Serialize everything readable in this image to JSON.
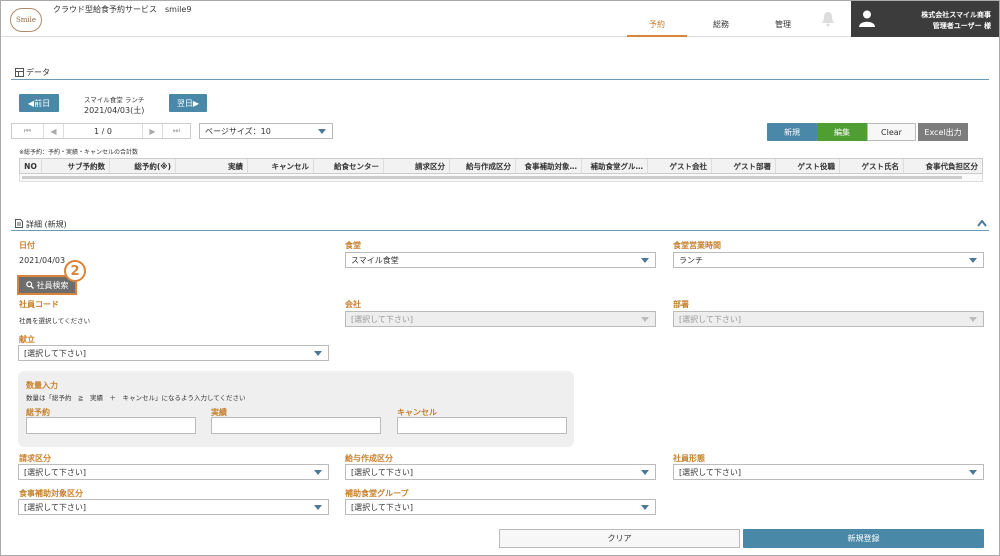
{
  "header": {
    "logo": "Smile",
    "title": "クラウド型給食予約サービス　smile9",
    "nav": [
      "予約",
      "総務",
      "管理"
    ],
    "company": "株式会社スマイル商事",
    "user": "管理者ユーザー 様"
  },
  "data_section": {
    "title": "データ",
    "prev_label": "◀前日",
    "next_label": "翌日▶",
    "canteen_meal": "スマイル食堂 ランチ",
    "date": "2021/04/03(土)",
    "pager_text": "1 / 0",
    "page_size": "ページサイズ：10",
    "new_label": "新規",
    "edit_label": "編集",
    "clear_label": "Clear",
    "excel_label": "Excel出力",
    "note": "※総予約：予約・実績・キャンセルの合計数",
    "columns": [
      "NO",
      "サブ予約数",
      "総予約(※)",
      "実績",
      "キャンセル",
      "給食センター",
      "請求区分",
      "給与作成区分",
      "食事補助対象…",
      "補助食堂グル…",
      "ゲスト会社",
      "ゲスト部署",
      "ゲスト役職",
      "ゲスト氏名",
      "食事代負担区分"
    ]
  },
  "detail": {
    "title": "詳細 (新規)",
    "date_label": "日付",
    "date_value": "2021/04/03",
    "canteen_label": "食堂",
    "canteen_value": "スマイル食堂",
    "hours_label": "食堂営業時間",
    "hours_value": "ランチ",
    "search_label": "社員検索",
    "callout": "2",
    "emp_code_label": "社員コード",
    "emp_hint": "社員を選択してください",
    "company_label": "会社",
    "dept_label": "部署",
    "placeholder": "[選択して下さい]",
    "menu_label": "献立",
    "qty_title": "数量入力",
    "qty_note": "数量は「総予約　≧　実績　＋　キャンセル」になるよう入力してください",
    "total_label": "総予約",
    "actual_label": "実績",
    "cancel_label": "キャンセル",
    "billing_label": "請求区分",
    "payroll_label": "給与作成区分",
    "emptype_label": "社員形態",
    "subsidy_label": "食事補助対象区分",
    "group_label": "補助食堂グループ",
    "clear_btn": "クリア",
    "register_btn": "新規登録"
  },
  "colors": {
    "accent": "#c7812d",
    "teal": "#4a88a8",
    "green": "#4f9e33",
    "callout": "#d9843a"
  }
}
